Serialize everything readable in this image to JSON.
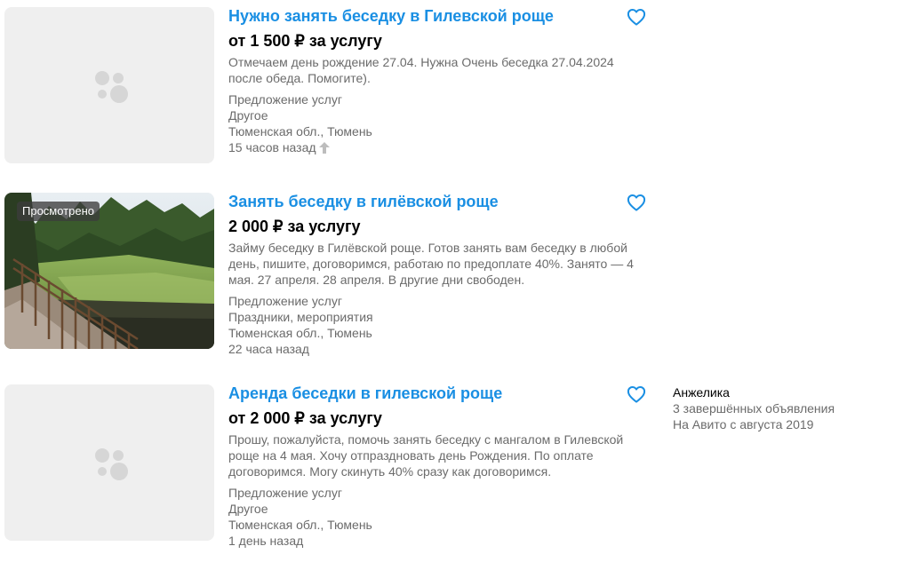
{
  "listings": [
    {
      "title": "Нужно занять беседку в Гилевской роще",
      "price": "от 1 500 ₽ за услугу",
      "description": "Отмечаем день рождение 27.04. Нужна Очень беседка 27.04.2024 после обеда. Помогите).",
      "type": "Предложение услуг",
      "category": "Другое",
      "location": "Тюменская обл., Тюмень",
      "date": "15 часов назад",
      "image": "placeholder-icon",
      "raised": true
    },
    {
      "title": "Занять беседку в гилёвской роще",
      "price": "2 000 ₽ за услугу",
      "description": "Займу беседку в Гилёвской роще. Готов занять вам беседку в любой день, пишите, договоримся, работаю по предоплате 40%. Занято — 4 мая. 27 апреля. 28 апреля. В другие дни свободен.",
      "type": "Предложение услуг",
      "category": "Праздники, мероприятия",
      "location": "Тюменская обл., Тюмень",
      "date": "22 часа назад",
      "badge": "Просмотрено",
      "image": "forest-photo"
    },
    {
      "title": "Аренда беседки в гилевской роще",
      "price": "от 2 000 ₽ за услугу",
      "description": "Прошу, пожалуйста, помочь занять беседку с мангалом в Гилевской роще на 4 мая. Хочу отпраздновать день Рождения. По оплате договоримся. Могу скинуть 40% сразу как договоримся.",
      "type": "Предложение услуг",
      "category": "Другое",
      "location": "Тюменская обл., Тюмень",
      "date": "1 день назад",
      "image": "placeholder-icon",
      "seller": {
        "name": "Анжелика",
        "completed": "3 завершённых объявления",
        "since": "На Авито с августа 2019"
      }
    }
  ],
  "colors": {
    "title_link": "#1a8fe3",
    "favorite_icon": "#1a8fe3",
    "secondary_text": "#6b6b6b",
    "placeholder_bg": "#efefef"
  }
}
